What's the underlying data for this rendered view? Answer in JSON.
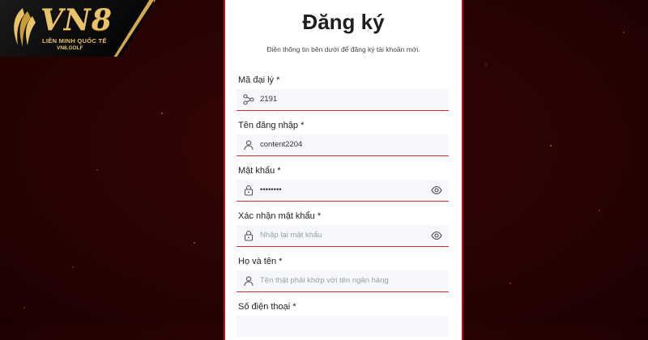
{
  "logo": {
    "main": "VN8",
    "sub": "LIÊN MINH QUỐC TẾ",
    "url": "VN8.GOLF"
  },
  "form": {
    "title": "Đăng ký",
    "subtitle": "Điền thông tin bên dưới để đăng ký tài khoản mới.",
    "fields": [
      {
        "label": "Mã đại lý *",
        "value": "2191",
        "icon": "share-icon"
      },
      {
        "label": "Tên đăng nhập *",
        "value": "content2204",
        "icon": "user-icon"
      },
      {
        "label": "Mật khẩu *",
        "value": "••••••••",
        "icon": "lock-icon",
        "toggle_icon": "eye-icon"
      },
      {
        "label": "Xác nhận mật khẩu *",
        "placeholder": "Nhập lại mật khẩu",
        "icon": "lock-icon",
        "toggle_icon": "eye-icon"
      },
      {
        "label": "Họ và tên *",
        "placeholder": "Tên thật phải khớp với tên ngân hàng",
        "icon": "user-icon"
      },
      {
        "label": "Số điện thoại *"
      }
    ]
  },
  "colors": {
    "background": "#2a0303",
    "accent": "#d43030",
    "gold": "#e8c36a"
  }
}
